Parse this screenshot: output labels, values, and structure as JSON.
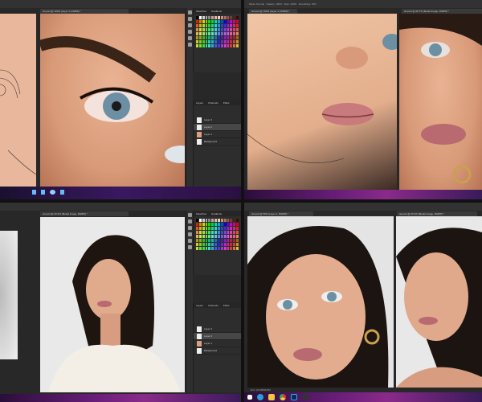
{
  "quadrants": [
    {
      "tab": "art-part @ 100% (Layer 3, RGB/8) *",
      "panel_tabs": [
        "Swatches",
        "Gradients"
      ],
      "layer_tabs": [
        "Layers",
        "Channels",
        "Paths"
      ],
      "layers": [
        "Layer 3",
        "Layer 2",
        "Layer 1",
        "Background"
      ]
    },
    {
      "tab": "art-part @ 100% (Layer 1, RGB/8) *",
      "tab2": "art-part @ 66.7% (Model Image, RGB/8) *",
      "options": [
        "Mode: Normal",
        "Opacity: 100%",
        "Flow: 100%",
        "Smoothing: 10%"
      ]
    },
    {
      "tab": "art-part @ 33.3% (Model Image, RGB/8) *",
      "panel_tabs": [
        "Swatches",
        "Gradients"
      ],
      "layer_tabs": [
        "Layers",
        "Channels",
        "Paths"
      ],
      "layers": [
        "Layer 3",
        "Layer 2",
        "Layer 1",
        "Background"
      ]
    },
    {
      "tab": "art-part @ 50% (Layer 1, RGB/8) *",
      "tab2": "art-part @ 33.3% (Model Image, RGB/8) *"
    }
  ],
  "status": "Doc: 24.0M/96.0M",
  "taskbar_icons": [
    "windows-icon",
    "edge-icon",
    "file-explorer-icon",
    "chrome-icon",
    "photoshop-icon",
    "obs-icon"
  ],
  "colors": {
    "accent": "#8a2a8a",
    "ps_bg": "#282828"
  }
}
